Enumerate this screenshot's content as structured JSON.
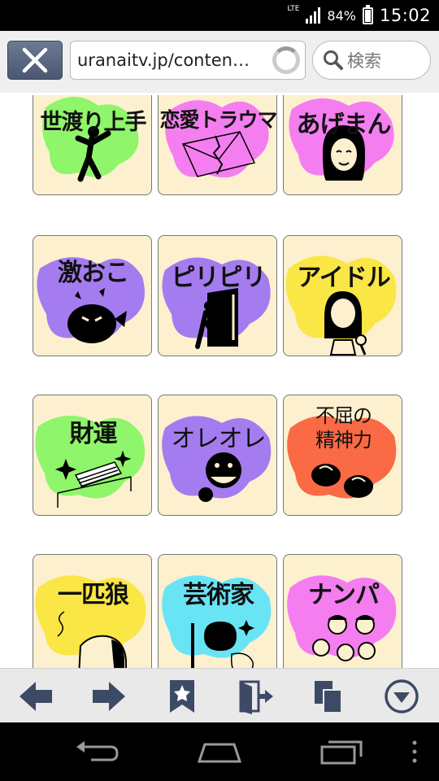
{
  "status": {
    "network": "LTE",
    "battery_pct": "84%",
    "battery_level": 0.84,
    "time": "15:02"
  },
  "browser": {
    "url": "uranaitv.jp/conten…",
    "search_placeholder": "検索",
    "load_progress": 0.89
  },
  "tiles": [
    {
      "label": "世渡り上手",
      "icon": "running-man-icon",
      "blob": "#8ff56a"
    },
    {
      "label": "恋愛トラウマ",
      "icon": "torn-letter-icon",
      "blob": "#f47ef0"
    },
    {
      "label": "あげまん",
      "icon": "smiling-woman-icon",
      "blob": "#f47ef0"
    },
    {
      "label": "激おこ",
      "icon": "angry-pufferfish-icon",
      "blob": "#a47cf0"
    },
    {
      "label": "ピリピリ",
      "icon": "door-figure-icon",
      "blob": "#a47cf0"
    },
    {
      "label": "アイドル",
      "icon": "idol-girl-icon",
      "blob": "#fae645"
    },
    {
      "label": "財運",
      "icon": "money-stack-icon",
      "blob": "#8ff56a"
    },
    {
      "label": "オレオレ",
      "icon": "grinning-face-icon",
      "blob": "#a47cf0"
    },
    {
      "label_line1": "不屈の",
      "label_line2": "精神力",
      "icon": "boxing-gloves-icon",
      "blob": "#fa6a45"
    },
    {
      "label": "一匹狼",
      "icon": "lone-man-icon",
      "blob": "#fae645"
    },
    {
      "label": "芸術家",
      "icon": "painter-icon",
      "blob": "#69e4f5"
    },
    {
      "label": "ナンパ",
      "icon": "people-group-icon",
      "blob": "#f47ef0"
    }
  ],
  "toolbar": {
    "back": "back-arrow-icon",
    "forward": "forward-arrow-icon",
    "bookmark": "bookmark-star-icon",
    "exit": "exit-door-icon",
    "tabs": "tabs-copy-icon",
    "menu": "menu-chevron-icon"
  }
}
